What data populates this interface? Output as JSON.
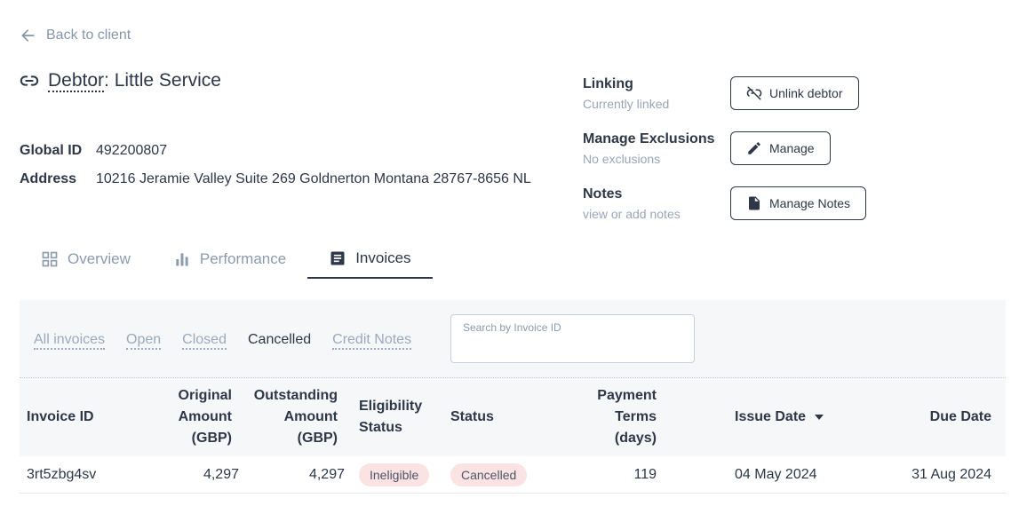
{
  "nav": {
    "back_label": "Back to client"
  },
  "debtor": {
    "title_prefix": "Debtor",
    "title_sep": ": ",
    "name": "Little Service",
    "global_id_label": "Global ID",
    "global_id": "492200807",
    "address_label": "Address",
    "address": "10216 Jeramie Valley Suite 269 Goldnerton Montana 28767-8656 NL"
  },
  "linking": {
    "title": "Linking",
    "sub": "Currently linked",
    "button": "Unlink debtor"
  },
  "exclusions": {
    "title": "Manage Exclusions",
    "sub": "No exclusions",
    "button": "Manage"
  },
  "notes": {
    "title": "Notes",
    "sub": "view or add notes",
    "button": "Manage Notes"
  },
  "tabs": [
    {
      "label": "Overview",
      "icon": "grid-icon"
    },
    {
      "label": "Performance",
      "icon": "bar-chart-icon"
    },
    {
      "label": "Invoices",
      "icon": "document-icon",
      "active": true
    }
  ],
  "filters": [
    {
      "label": "All invoices"
    },
    {
      "label": "Open"
    },
    {
      "label": "Closed"
    },
    {
      "label": "Cancelled",
      "active": true
    },
    {
      "label": "Credit Notes"
    }
  ],
  "search": {
    "label": "Search by Invoice ID",
    "value": ""
  },
  "table": {
    "headers": {
      "invoice_id": "Invoice ID",
      "original": [
        "Original",
        "Amount",
        "(GBP)"
      ],
      "outstanding": [
        "Outstanding",
        "Amount",
        "(GBP)"
      ],
      "eligibility": [
        "Eligibility",
        "Status"
      ],
      "status": "Status",
      "terms": [
        "Payment",
        "Terms",
        "(days)"
      ],
      "issue_date": "Issue Date",
      "due_date": "Due Date"
    },
    "rows": [
      {
        "invoice_id": "3rt5zbg4sv",
        "original": "4,297",
        "outstanding": "4,297",
        "eligibility": "Ineligible",
        "status": "Cancelled",
        "terms": "119",
        "issue_date": "04 May 2024",
        "due_date": "31 Aug 2024"
      }
    ]
  },
  "colors": {
    "text": "#2d3748",
    "muted": "#8c9aae",
    "pill_bg": "#fbe3e3",
    "panel_bg": "#f6f7f9"
  }
}
